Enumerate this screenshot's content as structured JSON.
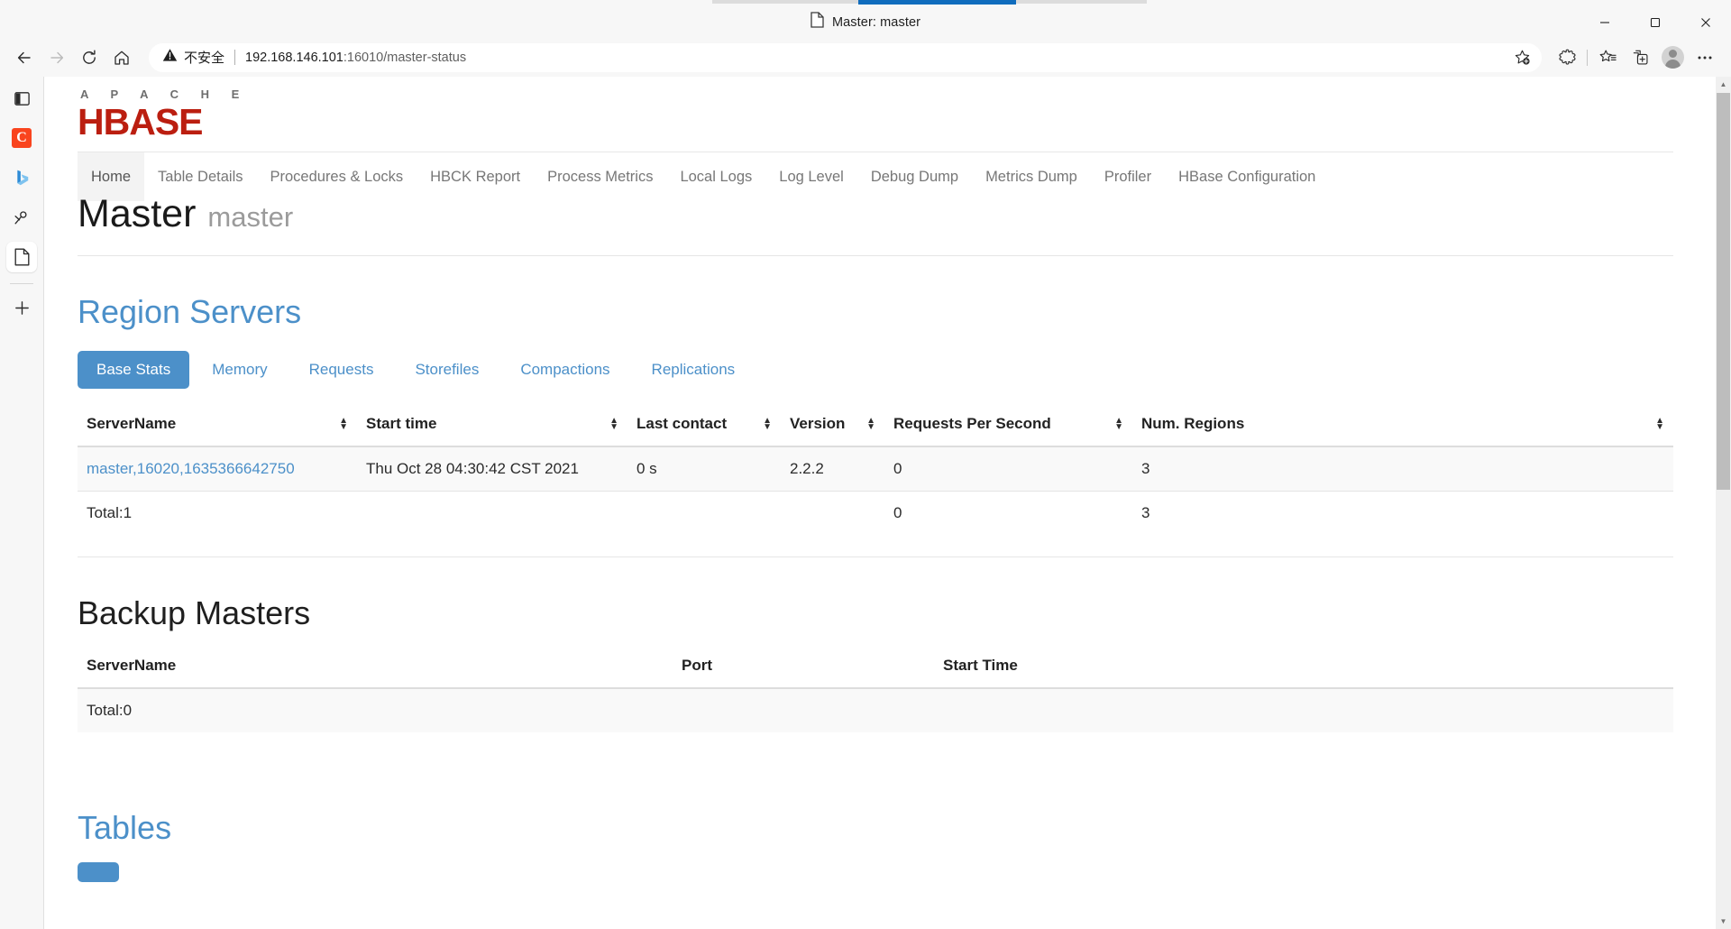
{
  "browser": {
    "window_title": "Master: master",
    "tab_title": "Master: master",
    "tab_icon": "page-icon",
    "window_controls": {
      "minimize": "─",
      "maximize": "❐",
      "close": "✕"
    },
    "toolbar": {
      "back": "←",
      "forward": "→",
      "refresh": "↻",
      "home": "⌂",
      "security_label": "不安全",
      "url_host": "192.168.146.101",
      "url_rest": ":16010/master-status",
      "url_full": "192.168.146.101:16010/master-status",
      "add_favorite": "add-favorite-star",
      "extensions": "extensions-puzzle",
      "favorites": "favorites-star-list",
      "collections": "collections",
      "profile": "profile-avatar",
      "settings_more": "⋯"
    },
    "sidebar": [
      {
        "name": "split-screen-icon",
        "label": "Split screen"
      },
      {
        "name": "copilot-icon",
        "label": "C"
      },
      {
        "name": "bing-discover-icon",
        "label": "b"
      },
      {
        "name": "drop-tool-icon",
        "label": "Drop"
      },
      {
        "name": "document-page-icon",
        "label": "Page",
        "selected": true
      },
      {
        "name": "add-sidebar-icon",
        "label": "+"
      }
    ]
  },
  "hbase": {
    "logo": {
      "top": "A P A C H E",
      "main": "HBASE"
    },
    "nav": [
      {
        "label": "Home",
        "active": true
      },
      {
        "label": "Table Details",
        "active": false
      },
      {
        "label": "Procedures & Locks",
        "active": false
      },
      {
        "label": "HBCK Report",
        "active": false
      },
      {
        "label": "Process Metrics",
        "active": false
      },
      {
        "label": "Local Logs",
        "active": false
      },
      {
        "label": "Log Level",
        "active": false
      },
      {
        "label": "Debug Dump",
        "active": false
      },
      {
        "label": "Metrics Dump",
        "active": false
      },
      {
        "label": "Profiler",
        "active": false
      },
      {
        "label": "HBase Configuration",
        "active": false
      }
    ],
    "master_heading": {
      "title": "Master",
      "subtitle": "master"
    },
    "region_servers": {
      "title": "Region Servers",
      "tabs": [
        {
          "label": "Base Stats",
          "active": true
        },
        {
          "label": "Memory",
          "active": false
        },
        {
          "label": "Requests",
          "active": false
        },
        {
          "label": "Storefiles",
          "active": false
        },
        {
          "label": "Compactions",
          "active": false
        },
        {
          "label": "Replications",
          "active": false
        }
      ],
      "columns": [
        "ServerName",
        "Start time",
        "Last contact",
        "Version",
        "Requests Per Second",
        "Num. Regions"
      ],
      "rows": [
        {
          "server_name": "master,16020,1635366642750",
          "start_time": "Thu Oct 28 04:30:42 CST 2021",
          "last_contact": "0 s",
          "version": "2.2.2",
          "requests_per_second": "0",
          "num_regions": "3"
        }
      ],
      "total_row": {
        "label": "Total:1",
        "start_time": "",
        "last_contact": "",
        "version": "",
        "requests_per_second": "0",
        "num_regions": "3"
      }
    },
    "backup_masters": {
      "title": "Backup Masters",
      "columns": [
        "ServerName",
        "Port",
        "Start Time"
      ],
      "rows": [],
      "total_row": {
        "label": "Total:0",
        "port": "",
        "start_time": ""
      }
    },
    "tables": {
      "title": "Tables",
      "button_label": ""
    }
  },
  "colors": {
    "hbase_red": "#bb1e10",
    "link_blue": "#4c90c9",
    "tab_active_blue": "#0f6cbd",
    "copilot_orange": "#f9441e"
  }
}
